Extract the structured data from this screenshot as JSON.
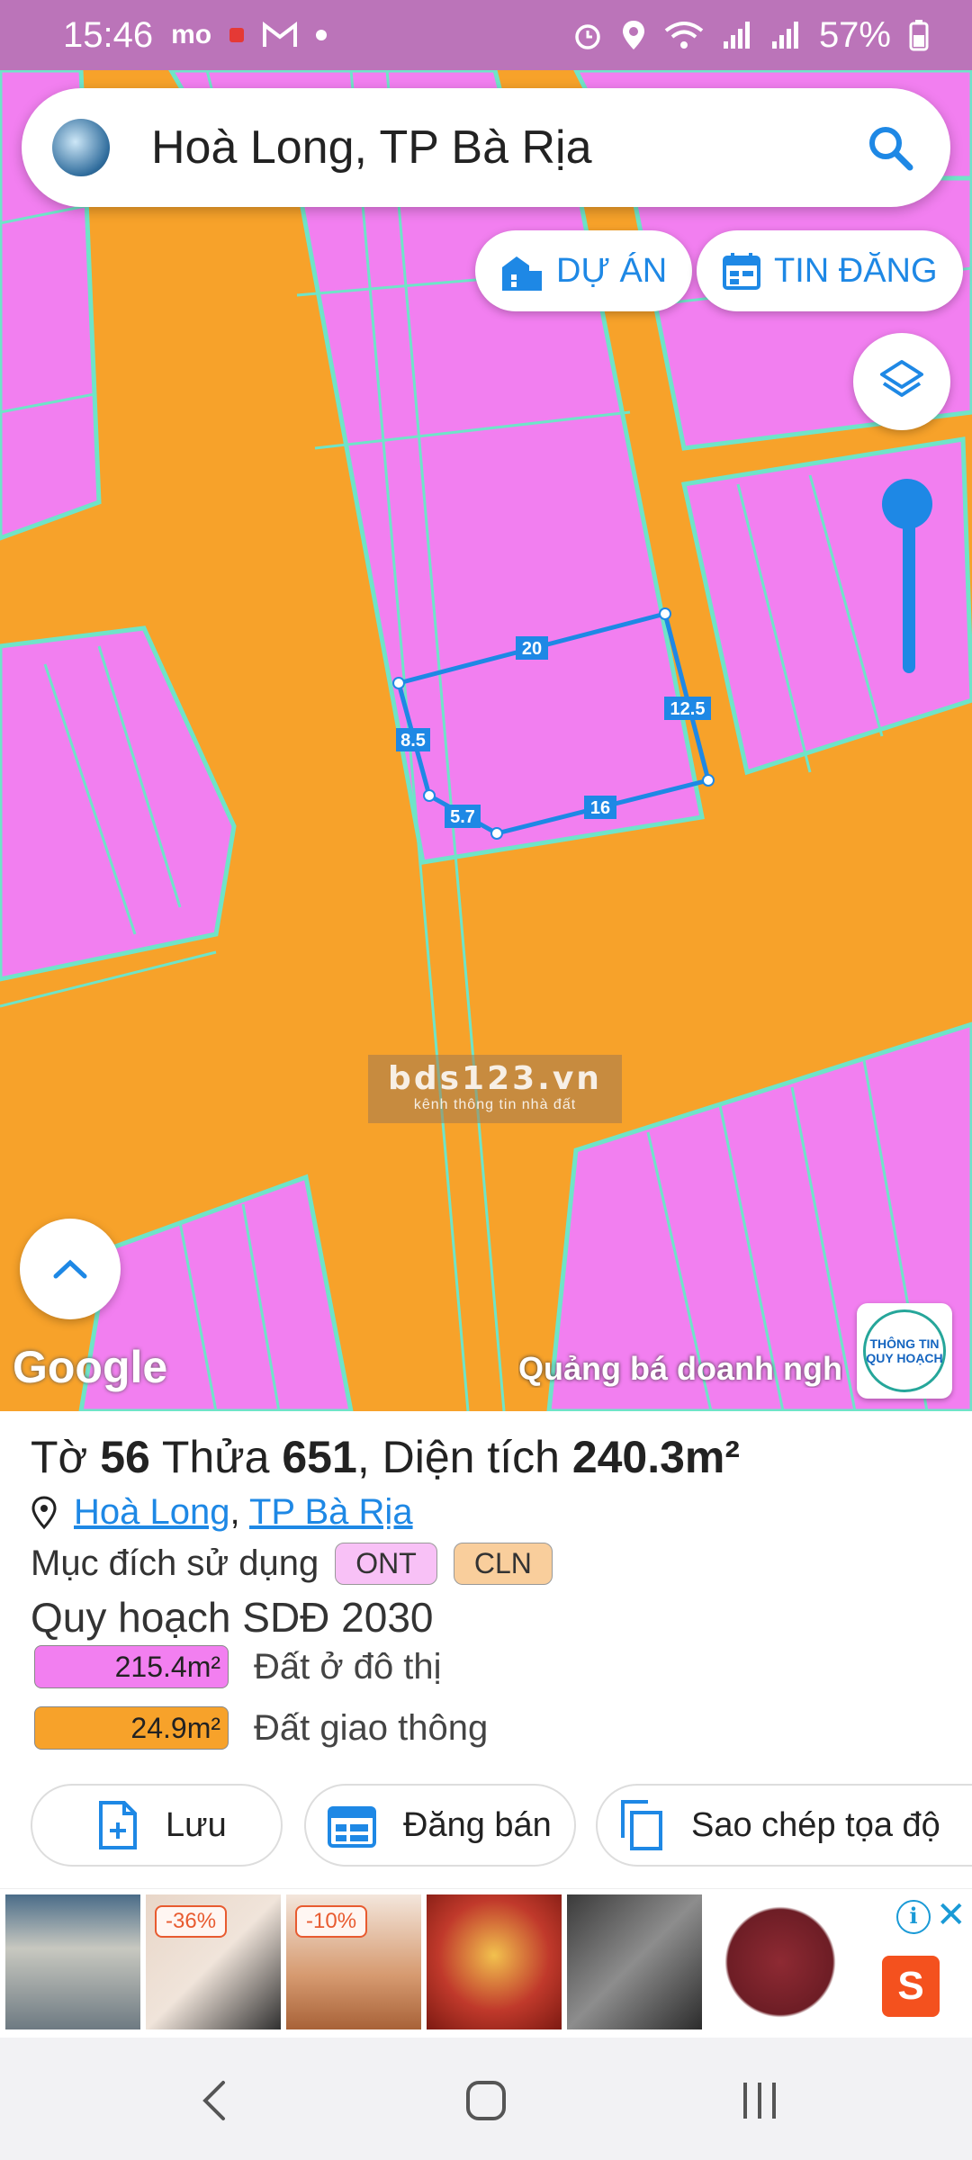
{
  "status_bar": {
    "time": "15:46",
    "left_icons": [
      "momo-icon",
      "notification-dot-icon",
      "gmail-icon",
      "dot-icon"
    ],
    "right_icons": [
      "alarm-icon",
      "location-icon",
      "wifi-icon",
      "signal-icon",
      "signal-icon",
      "battery-icon"
    ],
    "battery": "57%"
  },
  "search": {
    "query": "Hoà Long, TP Bà Rịa"
  },
  "map": {
    "buttons": {
      "du_an": "DỰ ÁN",
      "tin_dang": "TIN ĐĂNG"
    },
    "parcel_edges": {
      "top": "20",
      "right": "12.5",
      "left": "8.5",
      "bottom_left": "5.7",
      "bottom": "16"
    },
    "watermark": {
      "title": "bds123.vn",
      "subtitle": "kênh thông tin nhà đất"
    },
    "google_label": "Google",
    "ads_label": "Quảng bá doanh nghiệp",
    "badge": {
      "line1": "THÔNG TIN",
      "line2": "QUY HOẠCH"
    },
    "colors": {
      "residential": "#f27ff0",
      "transport": "#f7a22a",
      "boundary": "#6fe4c8",
      "parcel": "#1e88e5"
    }
  },
  "info": {
    "title_prefix": "Tờ ",
    "sheet": "56",
    "lot_label": " Thửa ",
    "lot": "651",
    "area_label": ", Diện tích ",
    "area": "240.3m²",
    "location": {
      "ward": "Hoà Long",
      "separator": ",",
      "city": "TP Bà Rịa"
    },
    "usage_label": "Mục đích sử dụng",
    "usage_tags": [
      "ONT",
      "CLN"
    ],
    "plan_title": "Quy hoạch SDĐ 2030",
    "plan_items": [
      {
        "value": "215.4m²",
        "label": "Đất ở đô thị",
        "color": "#f27ff0"
      },
      {
        "value": "24.9m²",
        "label": "Đất giao thông",
        "color": "#f7a22a"
      }
    ]
  },
  "actions": {
    "save": "Lưu",
    "post": "Đăng bán",
    "copy": "Sao chép tọa độ"
  },
  "ad_bar": {
    "discounts": [
      "-36%",
      "-10%"
    ],
    "info_icon": "i",
    "close_icon": "✕",
    "shop_icon": "S"
  },
  "nav": {
    "back": "back-icon",
    "home": "home-icon",
    "recents": "recents-icon"
  }
}
